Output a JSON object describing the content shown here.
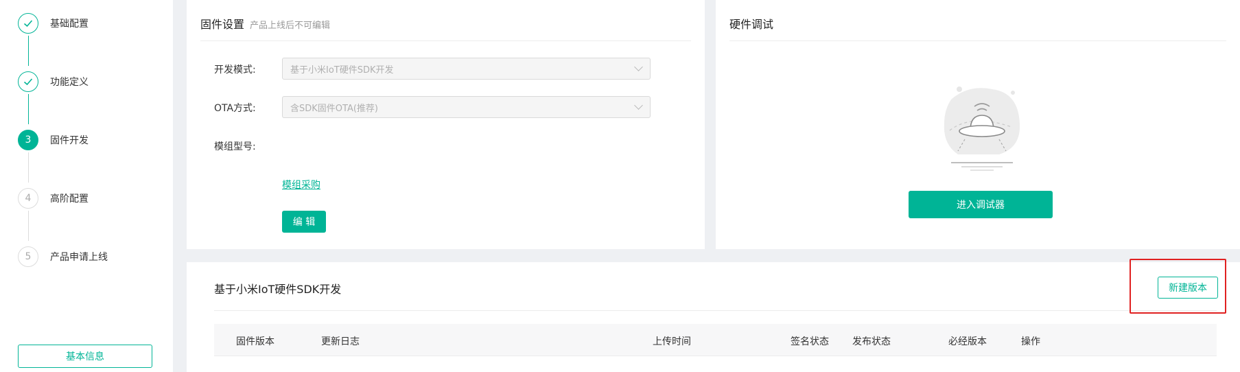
{
  "steps": [
    {
      "label": "基础配置",
      "state": "done",
      "num": ""
    },
    {
      "label": "功能定义",
      "state": "done",
      "num": ""
    },
    {
      "label": "固件开发",
      "state": "active",
      "num": "3"
    },
    {
      "label": "高阶配置",
      "state": "todo",
      "num": "4"
    },
    {
      "label": "产品申请上线",
      "state": "todo",
      "num": "5"
    }
  ],
  "sidebar": {
    "basic_info_label": "基本信息"
  },
  "firmware": {
    "title": "固件设置",
    "subtitle": "产品上线后不可编辑",
    "dev_mode_label": "开发模式:",
    "dev_mode_value": "基于小米IoT硬件SDK开发",
    "ota_label": "OTA方式:",
    "ota_value": "含SDK固件OTA(推荐)",
    "module_label": "模组型号:",
    "purchase_link": "模组采购",
    "edit_label": "编 辑"
  },
  "debug": {
    "title": "硬件调试",
    "enter_debugger_label": "进入调试器"
  },
  "versions": {
    "title": "基于小米IoT硬件SDK开发",
    "new_version_label": "新建版本",
    "columns": [
      "固件版本",
      "更新日志",
      "上传时间",
      "签名状态",
      "发布状态",
      "必经版本",
      "操作"
    ]
  },
  "colors": {
    "accent": "#00b496",
    "highlight": "#e02020"
  }
}
